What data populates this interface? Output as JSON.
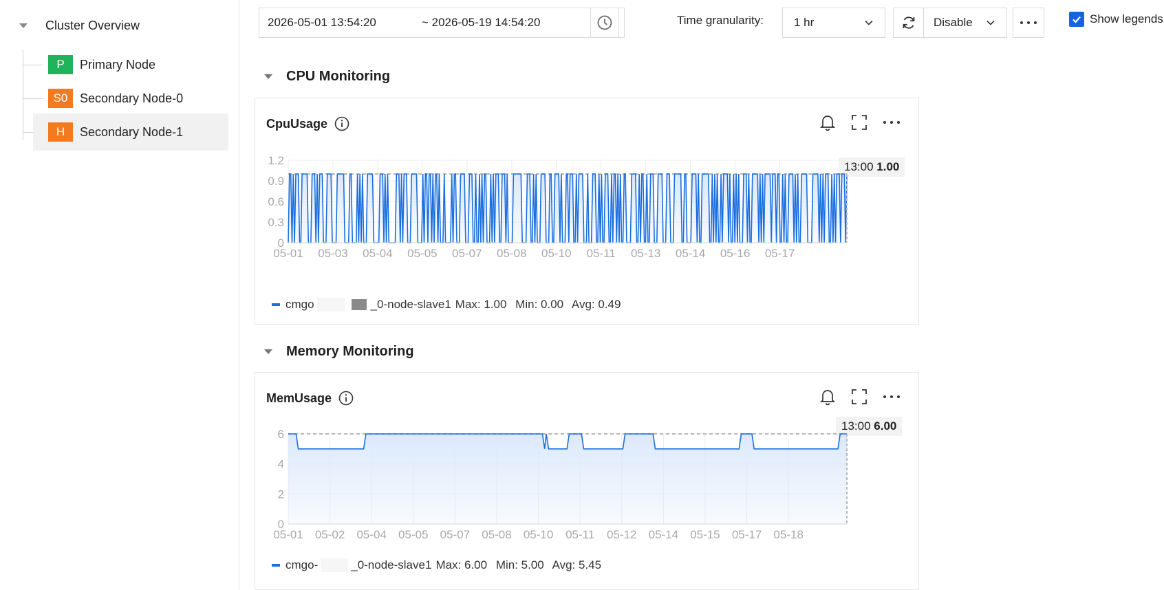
{
  "sidebar": {
    "root_label": "Cluster Overview",
    "items": [
      {
        "badge": "P",
        "label": "Primary Node",
        "badge_color": "#1fb35c"
      },
      {
        "badge": "S0",
        "label": "Secondary Node-0",
        "badge_color": "#f47a1f"
      },
      {
        "badge": "H",
        "label": "Secondary Node-1",
        "badge_color": "#f47a1f",
        "selected": true
      }
    ]
  },
  "toolbar": {
    "date_start": "2026-05-01 13:54:20",
    "date_end": "~ 2026-05-19 14:54:20",
    "granularity_label": "Time granularity:",
    "granularity_value": "1 hr",
    "auto_refresh_value": "Disable",
    "show_legends_label": "Show legends",
    "show_legends_checked": true
  },
  "sections": {
    "cpu": {
      "heading": "CPU Monitoring",
      "card_title": "CpuUsage",
      "tooltip_time": "13:00",
      "tooltip_value": "1.00",
      "legend_prefix": "cmgo",
      "legend_suffix": "_0-node-slave1",
      "legend_max": "Max: 1.00",
      "legend_min": "Min: 0.00",
      "legend_avg": "Avg: 0.49"
    },
    "memory": {
      "heading": "Memory Monitoring",
      "card_title": "MemUsage",
      "tooltip_time": "13:00",
      "tooltip_value": "6.00",
      "legend_prefix": "cmgo-",
      "legend_suffix": "_0-node-slave1",
      "legend_max": "Max: 6.00",
      "legend_min": "Min: 5.00",
      "legend_avg": "Avg: 5.45"
    }
  },
  "colors": {
    "accent": "#1565e0",
    "series": "#1a6fe0",
    "area_fill": "#dce9fb",
    "ref_line": "#b8b8b8"
  },
  "chart_data": [
    {
      "type": "area",
      "ylim": [
        0,
        1.2
      ],
      "yticks": [
        "0",
        "0.3",
        "0.6",
        "0.9",
        "1.2"
      ],
      "x_tick_labels": [
        "05-01",
        "05-03",
        "05-04",
        "05-05",
        "05-07",
        "05-08",
        "05-10",
        "05-11",
        "05-13",
        "05-14",
        "05-16",
        "05-17"
      ],
      "grid": true,
      "reference_line": 1.0,
      "series": [
        {
          "values": [
            0,
            1,
            1,
            0,
            1,
            0,
            1,
            1,
            1,
            0,
            0,
            1,
            1,
            1,
            1,
            1,
            0,
            0,
            0,
            1,
            1,
            1,
            0,
            1,
            0,
            1,
            1,
            1,
            0,
            0,
            0,
            1,
            1,
            1,
            1,
            0,
            0,
            0,
            0,
            1,
            1,
            1,
            1,
            1,
            1,
            0,
            0,
            0,
            0,
            1,
            1,
            0,
            0,
            0,
            0,
            1,
            0,
            1,
            0,
            1,
            0,
            0,
            0,
            1,
            1,
            1,
            1,
            1,
            0,
            0,
            0,
            0,
            0,
            1,
            1,
            1,
            0,
            1,
            0,
            1,
            0,
            0,
            0,
            0,
            0,
            0,
            1,
            1,
            1,
            0,
            1,
            0,
            1,
            1,
            1,
            0,
            0,
            0,
            1,
            1,
            1,
            1,
            1,
            0,
            0,
            0,
            0,
            1,
            0,
            1,
            1,
            0,
            1,
            1,
            0,
            1,
            0,
            1,
            1,
            0,
            1,
            0,
            0,
            0,
            1,
            0,
            0,
            0,
            0,
            0,
            1,
            0,
            1,
            1,
            0,
            0,
            0,
            1,
            1,
            1,
            1,
            0,
            0,
            0,
            1,
            1,
            1,
            0,
            0,
            1,
            0,
            0,
            1,
            0,
            1,
            0,
            1,
            1,
            0,
            0,
            0,
            1,
            0,
            1,
            0,
            1,
            1,
            1,
            0,
            0,
            1,
            1,
            1,
            0,
            1,
            0,
            0,
            0,
            0,
            1,
            1,
            1,
            1,
            1,
            1,
            1,
            0,
            0,
            0,
            0,
            1,
            1,
            1,
            0,
            0,
            1,
            0,
            1,
            0,
            0,
            0,
            1,
            1,
            1,
            1,
            0,
            0,
            0,
            1,
            1,
            0,
            0,
            1,
            1,
            1,
            1,
            0,
            1,
            0,
            0,
            0,
            1,
            1,
            0,
            1,
            1,
            1,
            0,
            0,
            1,
            0,
            1,
            1,
            1,
            1,
            0,
            0,
            0,
            1,
            0,
            0,
            0,
            1,
            1,
            1,
            0,
            0,
            1,
            0,
            1,
            0,
            0,
            1,
            1,
            1,
            0,
            0,
            1,
            0,
            1,
            1,
            0,
            1,
            0,
            1,
            0,
            0,
            1,
            1,
            0,
            0,
            0,
            0,
            1,
            1,
            1,
            1,
            0,
            0,
            1,
            0,
            1,
            1,
            0,
            0,
            1,
            0,
            0,
            1,
            1,
            1,
            0,
            0,
            0,
            1,
            1,
            1,
            1,
            0,
            0,
            0,
            1,
            1,
            1,
            0,
            0,
            0,
            1,
            1,
            1,
            1,
            1,
            1,
            0,
            0,
            1,
            1,
            0,
            0,
            0,
            0,
            1,
            1,
            1,
            1,
            0,
            1,
            0,
            0,
            1,
            1,
            1,
            1,
            1,
            1,
            0,
            0,
            1,
            0,
            1,
            0,
            1,
            0,
            0,
            1,
            0,
            1,
            1,
            1,
            1,
            0,
            1,
            0,
            0,
            1,
            0,
            1,
            0,
            1,
            0,
            0,
            0,
            1,
            1,
            1,
            0,
            1,
            0,
            0,
            1,
            1,
            1,
            1,
            1,
            0,
            1,
            0,
            1,
            0,
            1,
            1,
            1,
            1,
            1,
            0,
            1,
            1,
            1,
            0,
            1,
            1,
            0,
            0,
            1,
            0,
            1,
            0,
            0,
            1,
            1,
            1,
            1,
            0,
            1,
            0,
            1,
            0,
            0,
            1,
            1,
            1,
            1,
            1,
            0,
            0,
            0,
            0,
            1,
            1,
            1,
            1,
            1,
            0,
            1,
            0,
            1,
            0,
            1,
            1,
            1,
            0,
            0,
            1,
            0,
            1,
            0,
            1,
            1,
            1,
            0,
            1,
            1,
            1,
            0,
            1
          ]
        }
      ]
    },
    {
      "type": "area",
      "ylim": [
        0,
        6
      ],
      "yticks": [
        "0",
        "2",
        "4",
        "6"
      ],
      "x_tick_labels": [
        "05-01",
        "05-02",
        "05-04",
        "05-05",
        "05-07",
        "05-08",
        "05-10",
        "05-11",
        "05-12",
        "05-14",
        "05-15",
        "05-17",
        "05-18"
      ],
      "grid": true,
      "reference_line": 6.0,
      "series": [
        {
          "segments": [
            [
              0,
              6
            ],
            [
              0.014,
              6
            ],
            [
              0.018,
              5
            ],
            [
              0.135,
              5
            ],
            [
              0.139,
              6
            ],
            [
              0.455,
              6
            ],
            [
              0.459,
              5
            ],
            [
              0.462,
              6
            ],
            [
              0.466,
              5
            ],
            [
              0.499,
              5
            ],
            [
              0.503,
              6
            ],
            [
              0.525,
              6
            ],
            [
              0.529,
              5
            ],
            [
              0.599,
              5
            ],
            [
              0.603,
              6
            ],
            [
              0.653,
              6
            ],
            [
              0.657,
              5
            ],
            [
              0.807,
              5
            ],
            [
              0.811,
              6
            ],
            [
              0.83,
              6
            ],
            [
              0.834,
              5
            ],
            [
              0.984,
              5
            ],
            [
              0.988,
              6
            ],
            [
              1,
              6
            ]
          ]
        }
      ]
    }
  ]
}
